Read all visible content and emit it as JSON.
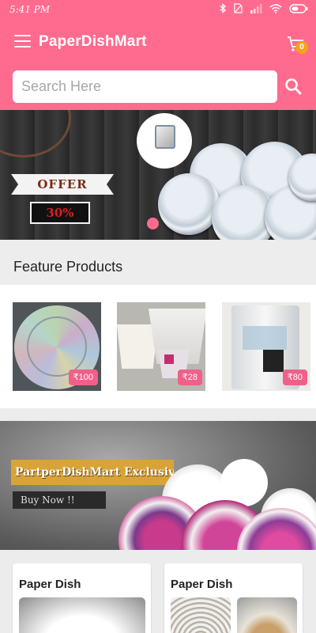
{
  "status_bar": {
    "time": "5:41 PM"
  },
  "app_bar": {
    "title": "PaperDishMart",
    "cart_count": "0"
  },
  "search": {
    "placeholder": "Search Here"
  },
  "hero_banner": {
    "ribbon_text": "OFFER",
    "discount_text": "30%",
    "active_slide": 1
  },
  "feature_section": {
    "title": "Feature Products"
  },
  "products": [
    {
      "price": "₹100"
    },
    {
      "price": "₹28"
    },
    {
      "price": "₹80"
    }
  ],
  "promo_banner": {
    "headline": "PartperDishMart Exclusiv",
    "cta": "Buy Now !!"
  },
  "categories": [
    {
      "title": "Paper Dish"
    },
    {
      "title": "Paper Dish"
    }
  ],
  "colors": {
    "primary": "#ff6b8f",
    "badge": "#f7a21b",
    "price": "#f0608a"
  }
}
